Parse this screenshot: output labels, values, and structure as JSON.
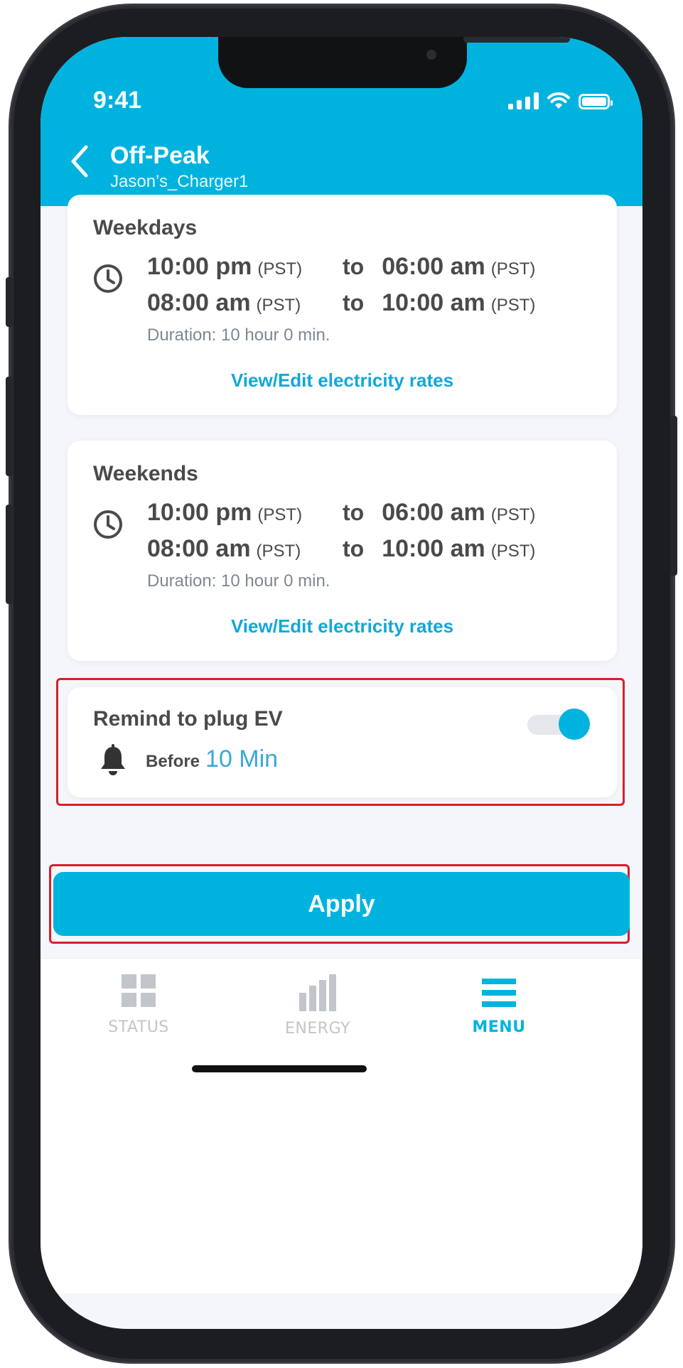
{
  "status_bar": {
    "time": "9:41"
  },
  "header": {
    "title": "Off-Peak",
    "subtitle": "Jason’s_Charger1"
  },
  "weekdays": {
    "title": "Weekdays",
    "slots": [
      {
        "start": "10:00 pm",
        "start_zone": "(PST)",
        "sep": "to",
        "end": "06:00 am",
        "end_zone": "(PST)"
      },
      {
        "start": "08:00 am",
        "start_zone": "(PST)",
        "sep": "to",
        "end": "10:00 am",
        "end_zone": "(PST)"
      }
    ],
    "duration": "Duration: 10 hour 0 min.",
    "link": "View/Edit electricity rates"
  },
  "weekends": {
    "title": "Weekends",
    "slots": [
      {
        "start": "10:00 pm",
        "start_zone": "(PST)",
        "sep": "to",
        "end": "06:00 am",
        "end_zone": "(PST)"
      },
      {
        "start": "08:00 am",
        "start_zone": "(PST)",
        "sep": "to",
        "end": "10:00 am",
        "end_zone": "(PST)"
      }
    ],
    "duration": "Duration: 10 hour 0 min.",
    "link": "View/Edit electricity rates"
  },
  "reminder": {
    "title": "Remind to plug EV",
    "enabled": true,
    "before_label": "Before",
    "before_value": "10 Min"
  },
  "apply_label": "Apply",
  "tabbar": {
    "items": [
      {
        "label": "STATUS",
        "active": false
      },
      {
        "label": "ENERGY",
        "active": false
      },
      {
        "label": "MENU",
        "active": true
      }
    ]
  },
  "colors": {
    "accent": "#00b3df",
    "link": "#11a8d8",
    "highlight": "#d61f2c",
    "inactive_tab": "#c2c5ca"
  }
}
